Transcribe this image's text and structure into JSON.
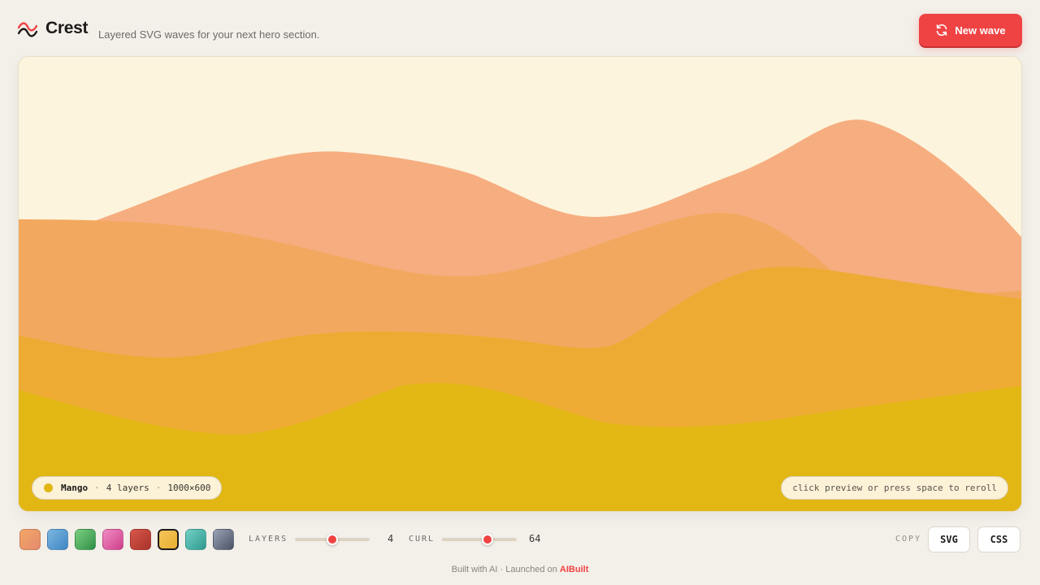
{
  "app": {
    "name": "Crest",
    "tagline": "Layered SVG waves for your next hero section.",
    "accent": "#ef4343",
    "logo_icon": "wave-logo-icon"
  },
  "header": {
    "new_wave_label": "New wave",
    "new_wave_icon": "refresh-icon"
  },
  "preview": {
    "background": "#fcf4dc",
    "layer_colors": [
      "#f6ad7f",
      "#f3a85f",
      "#edab33",
      "#e2b714"
    ],
    "palette_name": "Mango",
    "layers_text": "4 layers",
    "size_text": "1000×600",
    "separator": "·",
    "palette_dot_color": "#e2b714",
    "hint": "click preview or press space to reroll"
  },
  "palettes": {
    "selected_index": 5,
    "swatches": [
      {
        "name": "sunset",
        "from": "#f2a768",
        "to": "#e68a6c"
      },
      {
        "name": "ocean",
        "from": "#7bb6e0",
        "to": "#3f86c4"
      },
      {
        "name": "forest",
        "from": "#7ccf7e",
        "to": "#2f8f48"
      },
      {
        "name": "berry",
        "from": "#f08cc4",
        "to": "#cf3f8a"
      },
      {
        "name": "ember",
        "from": "#d8564c",
        "to": "#a83228"
      },
      {
        "name": "mango",
        "from": "#f6c45b",
        "to": "#e7b030"
      },
      {
        "name": "lagoon",
        "from": "#74d0c4",
        "to": "#2e9a8f"
      },
      {
        "name": "slate",
        "from": "#9aa3b5",
        "to": "#4a5266"
      }
    ]
  },
  "controls": {
    "layers": {
      "label": "LAYERS",
      "value": "4",
      "fraction": 0.5
    },
    "curl": {
      "label": "CURL",
      "value": "64",
      "fraction": 0.61
    }
  },
  "copy": {
    "label": "COPY",
    "svg_label": "SVG",
    "css_label": "CSS"
  },
  "footer": {
    "prefix": "Built with AI · Launched on",
    "link_label": "AIBuilt"
  }
}
